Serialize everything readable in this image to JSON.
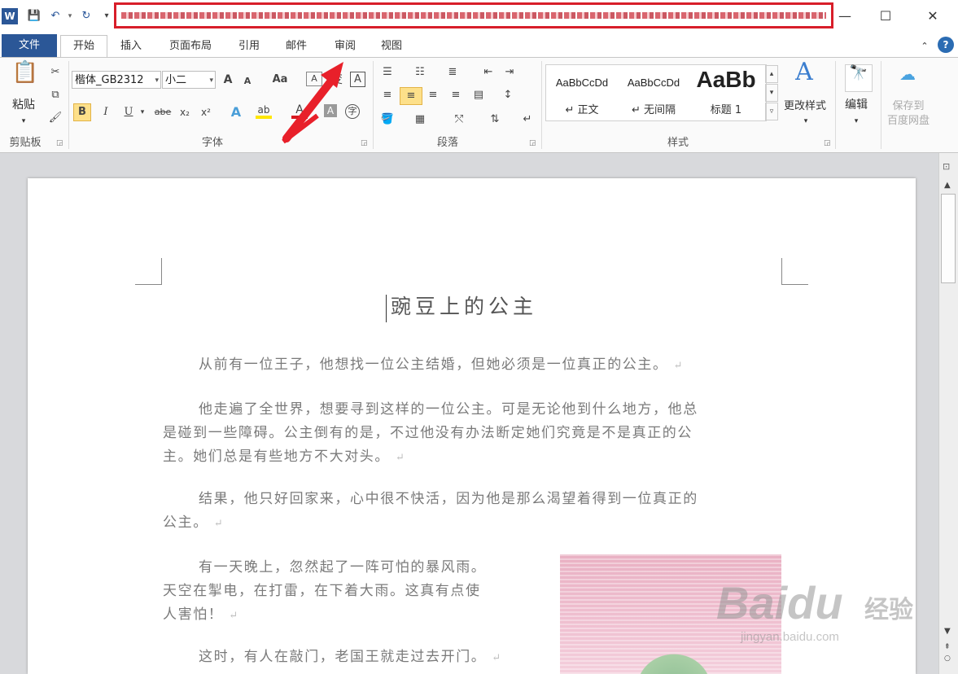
{
  "title_bar": {
    "word_icon_label": "W",
    "window_controls": {
      "minimize": "—",
      "maximize": "☐",
      "close": "✕"
    }
  },
  "tabs": [
    "文件",
    "开始",
    "插入",
    "页面布局",
    "引用",
    "邮件",
    "审阅",
    "视图"
  ],
  "ribbon": {
    "clipboard": {
      "paste": "粘贴",
      "label": "剪贴板"
    },
    "font": {
      "font_name": "楷体_GB2312",
      "font_size": "小二",
      "bold": "B",
      "italic": "I",
      "underline": "U",
      "strike": "abe",
      "subscript": "x₂",
      "superscript": "x²",
      "grow": "A",
      "shrink": "A",
      "case": "Aa",
      "label": "字体"
    },
    "paragraph": {
      "label": "段落"
    },
    "styles": {
      "items": [
        {
          "sample": "AaBbCcDd",
          "name": "↵ 正文"
        },
        {
          "sample": "AaBbCcDd",
          "name": "↵ 无间隔"
        },
        {
          "sample": "AaBb",
          "name": "标题 1"
        }
      ],
      "change_styles": "更改样式",
      "label": "样式"
    },
    "editing": {
      "label": "编辑"
    },
    "save": {
      "line1": "保存到",
      "line2": "百度网盘"
    }
  },
  "document": {
    "title": "豌豆上的公主",
    "paragraphs": [
      [
        "从前有一位王子，他想找一位公主结婚，但她必须是一位真正的公主。"
      ],
      [
        "他走遍了全世界，想要寻到这样的一位公主。可是无论他到什么地方，他总",
        "是碰到一些障碍。公主倒有的是，不过他没有办法断定她们究竟是不是真正的公",
        "主。她们总是有些地方不大对头。"
      ],
      [
        "结果，他只好回家来，心中很不快活，因为他是那么渴望着得到一位真正的",
        "公主。"
      ],
      [
        "有一天晚上，忽然起了一阵可怕的暴风雨。",
        "天空在掣电，在打雷，在下着大雨。这真有点使",
        "人害怕！"
      ],
      [
        "这时，有人在敲门，老国王就走过去开门。"
      ]
    ]
  },
  "watermark": {
    "brand": "Baidu",
    "cn": "经验",
    "url": "jingyan.baidu.com"
  },
  "colors": {
    "file_tab": "#2b5797",
    "highlight_box": "#d81e2a",
    "arrow": "#e8202a"
  }
}
